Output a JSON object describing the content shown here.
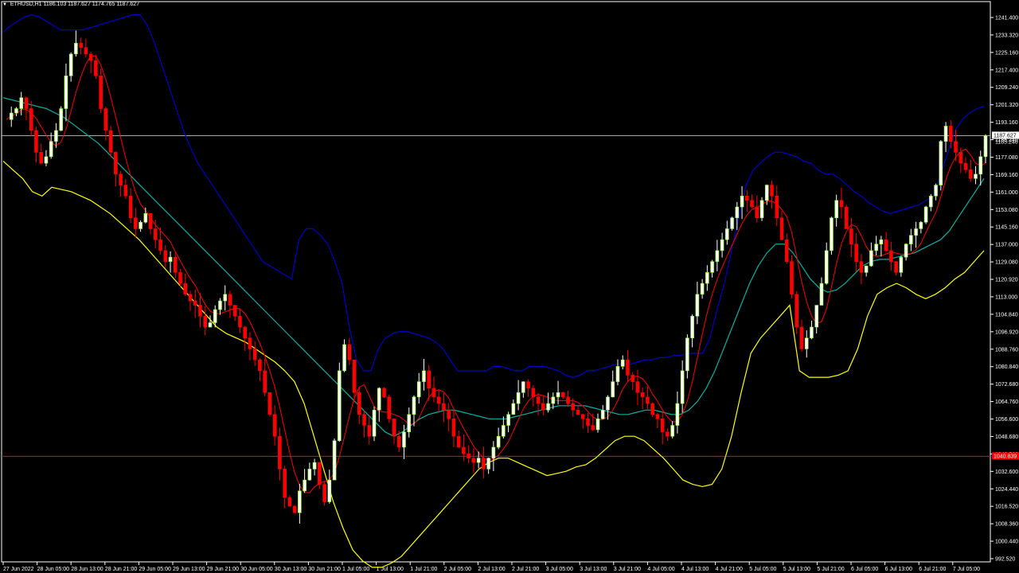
{
  "header": {
    "symbol": "ETHUSD,H1",
    "ohlc": "1186.103 1187.627 1174.765 1187.627"
  },
  "price_labels": {
    "current": "1187.627",
    "current_alt": "1185.240",
    "red_line": "1040.839"
  },
  "colors": {
    "background": "#000000",
    "bull_candle": "#ffffff",
    "bear_candle": "#ff0000",
    "volume_candle": "#7cfc00",
    "upper_band": "#0000cc",
    "middle_band": "#00b3a4",
    "lower_band": "#ffff00",
    "fast_ma": "#ff0000",
    "price_line": "#c0c0c0",
    "red_hline": "#ff0000"
  },
  "chart_data": {
    "type": "line",
    "title": "ETHUSD,H1",
    "ylim": [
      992.52,
      1249.0
    ],
    "yticks": [
      "1241.400",
      "1233.320",
      "1225.160",
      "1217.400",
      "1209.240",
      "1201.320",
      "1193.160",
      "1185.240",
      "1177.080",
      "1169.160",
      "1161.000",
      "1153.080",
      "1145.160",
      "1137.000",
      "1129.080",
      "1120.920",
      "1113.000",
      "1104.840",
      "1096.920",
      "1088.760",
      "1080.840",
      "1072.680",
      "1064.760",
      "1056.600",
      "1048.680",
      "1040.560",
      "1032.600",
      "1024.440",
      "1016.520",
      "1008.360",
      "1000.440",
      "992.520"
    ],
    "xticks": [
      "27 Jun 2022",
      "28 Jun 05:00",
      "28 Jun 13:00",
      "28 Jun 21:00",
      "29 Jun 05:00",
      "29 Jun 13:00",
      "29 Jun 21:00",
      "30 Jun 05:00",
      "30 Jun 13:00",
      "30 Jun 21:00",
      "1 Jul 05:00",
      "1 Jul 13:00",
      "1 Jul 21:00",
      "2 Jul 05:00",
      "2 Jul 13:00",
      "2 Jul 21:00",
      "3 Jul 05:00",
      "3 Jul 13:00",
      "3 Jul 21:00",
      "4 Jul 05:00",
      "4 Jul 13:00",
      "4 Jul 21:00",
      "5 Jul 05:00",
      "5 Jul 13:00",
      "5 Jul 21:00",
      "6 Jul 05:00",
      "6 Jul 13:00",
      "6 Jul 21:00",
      "7 Jul 05:00"
    ],
    "close": [
      1195,
      1198,
      1200,
      1205,
      1200,
      1190,
      1180,
      1175,
      1178,
      1185,
      1190,
      1200,
      1215,
      1225,
      1230,
      1228,
      1225,
      1222,
      1215,
      1200,
      1190,
      1180,
      1170,
      1165,
      1160,
      1150,
      1145,
      1148,
      1152,
      1145,
      1140,
      1135,
      1130,
      1132,
      1125,
      1120,
      1115,
      1112,
      1110,
      1105,
      1100,
      1102,
      1108,
      1112,
      1115,
      1110,
      1105,
      1100,
      1095,
      1090,
      1085,
      1080,
      1070,
      1060,
      1050,
      1035,
      1022,
      1018,
      1015,
      1025,
      1030,
      1035,
      1038,
      1028,
      1020,
      1030,
      1048,
      1080,
      1092,
      1085,
      1070,
      1060,
      1055,
      1050,
      1062,
      1072,
      1068,
      1058,
      1050,
      1045,
      1052,
      1060,
      1068,
      1075,
      1080,
      1072,
      1068,
      1065,
      1062,
      1058,
      1050,
      1045,
      1042,
      1040,
      1038,
      1040,
      1035,
      1040,
      1045,
      1050,
      1055,
      1060,
      1065,
      1070,
      1075,
      1072,
      1068,
      1065,
      1062,
      1065,
      1068,
      1070,
      1068,
      1065,
      1062,
      1060,
      1058,
      1055,
      1053,
      1058,
      1062,
      1068,
      1075,
      1082,
      1085,
      1078,
      1075,
      1070,
      1068,
      1065,
      1060,
      1058,
      1052,
      1050,
      1055,
      1065,
      1080,
      1095,
      1105,
      1115,
      1120,
      1125,
      1130,
      1135,
      1140,
      1145,
      1150,
      1155,
      1160,
      1158,
      1155,
      1150,
      1158,
      1165,
      1160,
      1150,
      1140,
      1130,
      1115,
      1100,
      1090,
      1095,
      1100,
      1110,
      1120,
      1135,
      1150,
      1158,
      1155,
      1145,
      1138,
      1130,
      1125,
      1128,
      1135,
      1138,
      1140,
      1135,
      1130,
      1125,
      1132,
      1138,
      1142,
      1145,
      1148,
      1155,
      1160,
      1165,
      1185,
      1192,
      1185,
      1180,
      1175,
      1172,
      1168,
      1170,
      1178,
      1187.627
    ],
    "upper": [
      1235,
      1238,
      1240,
      1242,
      1243,
      1242,
      1240,
      1238,
      1236,
      1236,
      1236,
      1236,
      1237,
      1238,
      1239,
      1240,
      1241,
      1242,
      1243,
      1243,
      1238,
      1230,
      1220,
      1210,
      1200,
      1190,
      1182,
      1175,
      1170,
      1165,
      1160,
      1155,
      1150,
      1145,
      1140,
      1135,
      1130,
      1128,
      1126,
      1124,
      1122,
      1140,
      1145,
      1145,
      1142,
      1138,
      1130,
      1120,
      1100,
      1085,
      1080,
      1080,
      1090,
      1095,
      1097,
      1098,
      1098,
      1097,
      1096,
      1095,
      1093,
      1090,
      1085,
      1080,
      1080,
      1080,
      1080,
      1080,
      1082,
      1082,
      1081,
      1080,
      1080,
      1082,
      1082,
      1082,
      1081,
      1080,
      1078,
      1077,
      1078,
      1080,
      1080,
      1081,
      1082,
      1083,
      1083,
      1083,
      1084,
      1085,
      1085,
      1086,
      1086,
      1087,
      1087,
      1088,
      1088,
      1088,
      1095,
      1108,
      1120,
      1135,
      1150,
      1165,
      1172,
      1175,
      1178,
      1180,
      1180,
      1179,
      1178,
      1176,
      1175,
      1172,
      1170,
      1170,
      1168,
      1165,
      1162,
      1160,
      1157,
      1155,
      1153,
      1152,
      1153,
      1154,
      1155,
      1156,
      1158,
      1160,
      1170,
      1180,
      1190,
      1195,
      1198,
      1200,
      1201
    ],
    "middle": [
      1205,
      1204,
      1203,
      1202,
      1201,
      1200,
      1198,
      1196,
      1193,
      1190,
      1187,
      1184,
      1180,
      1176,
      1172,
      1168,
      1164,
      1160,
      1156,
      1152,
      1148,
      1144,
      1140,
      1136,
      1132,
      1128,
      1124,
      1120,
      1116,
      1112,
      1108,
      1104,
      1100,
      1096,
      1092,
      1088,
      1084,
      1080,
      1076,
      1072,
      1068,
      1064,
      1060,
      1056,
      1052,
      1050,
      1052,
      1055,
      1058,
      1060,
      1061,
      1062,
      1062,
      1061,
      1060,
      1059,
      1058,
      1058,
      1058,
      1059,
      1060,
      1061,
      1062,
      1063,
      1064,
      1064,
      1064,
      1064,
      1063,
      1062,
      1061,
      1060,
      1060,
      1061,
      1062,
      1062,
      1061,
      1060,
      1060,
      1062,
      1066,
      1072,
      1080,
      1090,
      1100,
      1110,
      1120,
      1128,
      1134,
      1138,
      1138,
      1134,
      1128,
      1122,
      1118,
      1116,
      1117,
      1120,
      1124,
      1128,
      1130,
      1131,
      1131,
      1132,
      1133,
      1134,
      1136,
      1138,
      1140,
      1144,
      1150,
      1156,
      1162,
      1168
    ],
    "lower": [
      1176,
      1172,
      1168,
      1162,
      1160,
      1164,
      1163,
      1162,
      1160,
      1158,
      1155,
      1152,
      1148,
      1144,
      1140,
      1135,
      1130,
      1125,
      1120,
      1115,
      1110,
      1105,
      1100,
      1097,
      1095,
      1093,
      1090,
      1087,
      1084,
      1080,
      1075,
      1065,
      1050,
      1035,
      1020,
      1008,
      998,
      993,
      990,
      990,
      992,
      995,
      1000,
      1005,
      1010,
      1015,
      1020,
      1025,
      1030,
      1035,
      1038,
      1040,
      1040,
      1038,
      1036,
      1034,
      1032,
      1033,
      1034,
      1036,
      1037,
      1040,
      1044,
      1048,
      1050,
      1050,
      1048,
      1044,
      1040,
      1035,
      1030,
      1028,
      1027,
      1028,
      1035,
      1050,
      1070,
      1088,
      1095,
      1100,
      1105,
      1110,
      1080,
      1077,
      1077,
      1077,
      1078,
      1080,
      1090,
      1105,
      1115,
      1118,
      1120,
      1118,
      1115,
      1113,
      1115,
      1118,
      1122,
      1125,
      1130,
      1135
    ]
  }
}
